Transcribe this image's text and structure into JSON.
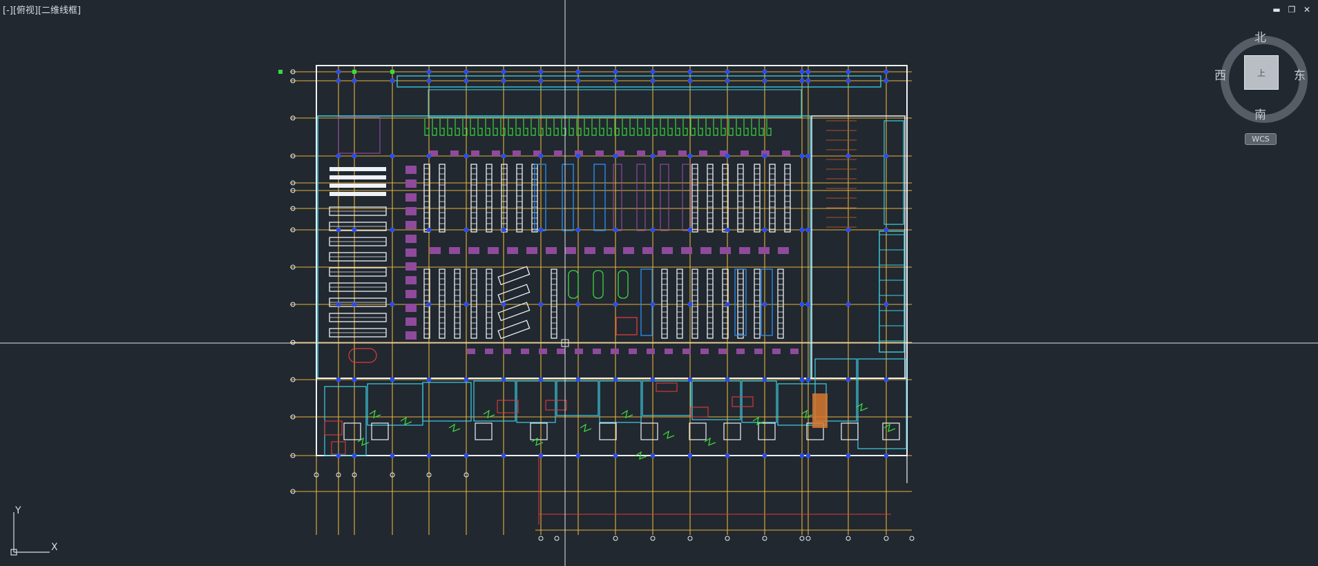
{
  "viewport": {
    "label": "[-][俯视][二维线框]"
  },
  "window_controls": {
    "minimize": "▬",
    "restore": "❐",
    "close": "✕"
  },
  "viewcube": {
    "north": "北",
    "south": "南",
    "east": "东",
    "west": "西",
    "top_face": "上",
    "wcs": "WCS"
  },
  "ucs": {
    "x_label": "X",
    "y_label": "Y"
  },
  "colors": {
    "background": "#212830",
    "grid_axis": "#e8b23a",
    "wall": "#eef2f6",
    "cyan": "#3fd0e6",
    "blue": "#2b4de8",
    "green": "#3cd93c",
    "magenta": "#8f4a9c",
    "red": "#e23a3a",
    "crosshair": "#e6e6e6"
  }
}
